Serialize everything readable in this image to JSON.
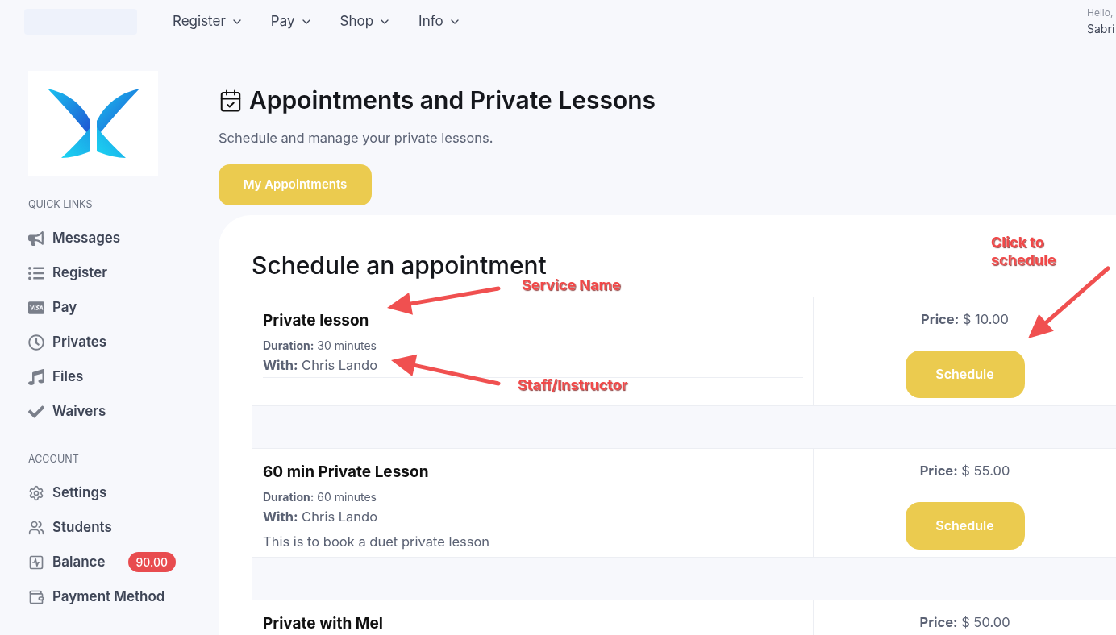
{
  "nav": {
    "items": [
      {
        "label": "Register"
      },
      {
        "label": "Pay"
      },
      {
        "label": "Shop"
      },
      {
        "label": "Info"
      }
    ],
    "greeting": "Hello,",
    "user": "Sabri"
  },
  "sidebar": {
    "sections": [
      {
        "title": "QUICK LINKS",
        "items": [
          {
            "label": "Messages"
          },
          {
            "label": "Register"
          },
          {
            "label": "Pay"
          },
          {
            "label": "Privates"
          },
          {
            "label": "Files"
          },
          {
            "label": "Waivers"
          }
        ]
      },
      {
        "title": "ACCOUNT",
        "items": [
          {
            "label": "Settings"
          },
          {
            "label": "Students"
          },
          {
            "label": "Balance",
            "badge": "90.00"
          },
          {
            "label": "Payment Method"
          }
        ]
      }
    ]
  },
  "page": {
    "title": "Appointments and Private Lessons",
    "subtitle": "Schedule and manage your private lessons.",
    "button": "My Appointments"
  },
  "schedule": {
    "title": "Schedule an appointment",
    "services": [
      {
        "name": "Private lesson",
        "duration": "**Duration:** 30 minutes",
        "with": "**With:** Chris Lando",
        "price": "**Price:** $ 10.00",
        "button": "Schedule"
      },
      {
        "name": "60 min Private Lesson",
        "duration": "**Duration:** 60 minutes",
        "with": "**With:** Chris Lando",
        "description": "This is to book a duet private lesson",
        "price": "**Price:** $ 55.00",
        "button": "Schedule"
      },
      {
        "name": "Private with Mel",
        "price": "**Price:** $ 50.00"
      }
    ]
  },
  "annotations": [
    {
      "text": "Service Name"
    },
    {
      "text": "Staff/Instructor"
    },
    {
      "text": "Click to schedule"
    }
  ]
}
